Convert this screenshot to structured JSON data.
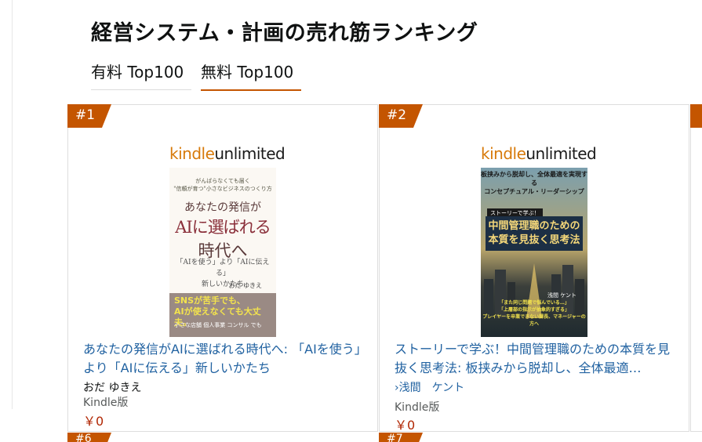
{
  "page_title": "経営システム・計画の売れ筋ランキング",
  "tabs": [
    {
      "label": "有料 Top100",
      "selected": false
    },
    {
      "label": "無料 Top100",
      "selected": true
    }
  ],
  "colors": {
    "accent": "#C45500",
    "link": "#2162A1",
    "price": "#B12704"
  },
  "ku_logo": {
    "kindle": "kindle",
    "unlimited": "unlimited"
  },
  "products": [
    {
      "rank": "#1",
      "title": "あなたの発信がAIに選ばれる時代へ: 「AIを使う」より「AIに伝える」新しいかたち",
      "author": "おだ ゆきえ",
      "format": "Kindle版",
      "price": "￥0",
      "cover": {
        "sub1": "がんばらなくても届く",
        "sub2": "\"信頼が育つ\"小さなビジネスのつくり方",
        "t1": "あなたの発信が",
        "t2": "AIに選ばれる",
        "t3": "時代へ",
        "mid1": "「AIを使う」より「AIに伝える」",
        "mid2": "新しいかたち",
        "author": "おだ ゆきえ",
        "band1": "SNSが苦手でも、",
        "band2": "AIが使えなくても大丈夫。",
        "band3": "小さな店舗 個人事業 コンサル でも"
      }
    },
    {
      "rank": "#2",
      "title": "ストーリーで学ぶ！中間管理職のための本質を見抜く思考法: 板挟みから脱却し、全体最適…",
      "author": "›浅間　ケント",
      "format": "Kindle版",
      "price": "￥0",
      "cover": {
        "top1": "板挟みから脱却し、全体最適を実現する",
        "top2": "コンセプチュアル・リーダーシップ",
        "badge": "ストーリーで学ぶ！",
        "t1": "中間管理職のための",
        "t2": "本質を見抜く思考法",
        "author": "浅間 ケント",
        "b1": "「また同じ問題で悩んでいる…」",
        "b2": "「上層部の指示が抽象的すぎる」",
        "b3": "プレイヤーを卒業できない課長、マネージャーの方へ"
      }
    }
  ],
  "next_ranks": [
    "#6",
    "#7"
  ]
}
